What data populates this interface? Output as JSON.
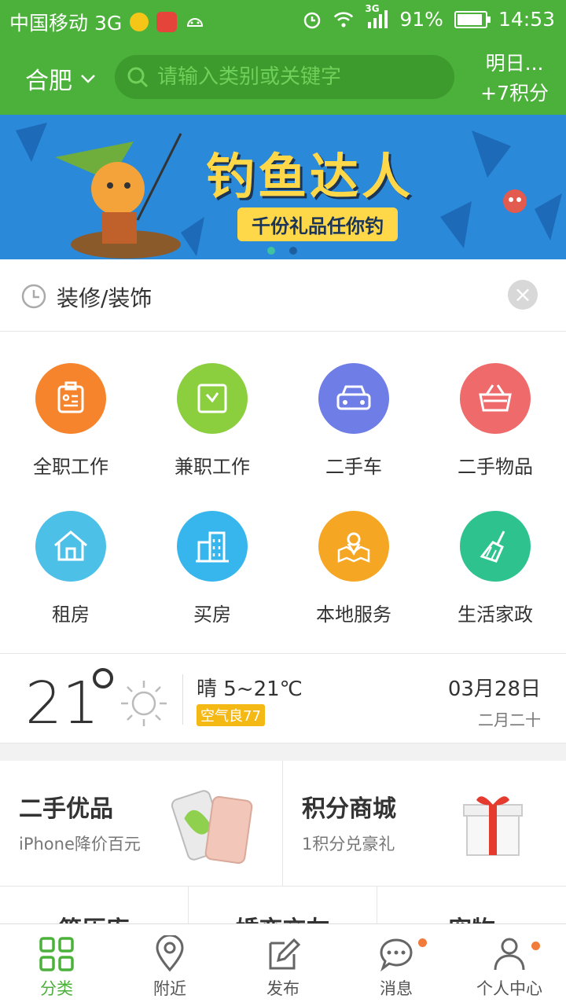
{
  "status_bar": {
    "carrier": "中国移动 3G",
    "network": "3G",
    "battery": "91%",
    "battery_level": 0.91,
    "time": "14:53"
  },
  "header": {
    "city": "合肥",
    "search_placeholder": "请输入类别或关键字",
    "checkin_line1": "明日...",
    "checkin_line2": "+7积分"
  },
  "banner": {
    "title": "钓鱼达人",
    "subtitle": "千份礼品任你钓",
    "active_index": 0,
    "count": 2
  },
  "history": {
    "text": "装修/装饰"
  },
  "categories": [
    {
      "label": "全职工作",
      "icon": "badge-icon",
      "color": "#f5842d"
    },
    {
      "label": "兼职工作",
      "icon": "clock-icon",
      "color": "#8bcf3f"
    },
    {
      "label": "二手车",
      "icon": "car-icon",
      "color": "#6e7ee6"
    },
    {
      "label": "二手物品",
      "icon": "basket-icon",
      "color": "#ef6a6a"
    },
    {
      "label": "租房",
      "icon": "house-icon",
      "color": "#4dc0e8"
    },
    {
      "label": "买房",
      "icon": "building-icon",
      "color": "#37b6ee"
    },
    {
      "label": "本地服务",
      "icon": "map-person-icon",
      "color": "#f5a623"
    },
    {
      "label": "生活家政",
      "icon": "broom-icon",
      "color": "#2ec28e"
    }
  ],
  "weather": {
    "temperature": "21",
    "condition": "晴 5~21℃",
    "aqi": "空气良77",
    "date": "03月28日",
    "lunar": "二月二十"
  },
  "promos": [
    {
      "title": "二手优品",
      "subtitle": "iPhone降价百元",
      "icon": "phone-icon"
    },
    {
      "title": "积分商城",
      "subtitle": "1积分兑豪礼",
      "icon": "gift-icon"
    }
  ],
  "promo_row3": [
    "简历库",
    "婚恋交友",
    "宠物"
  ],
  "nav": [
    {
      "label": "分类",
      "icon": "grid-icon",
      "active": true
    },
    {
      "label": "附近",
      "icon": "location-pin-icon",
      "active": false
    },
    {
      "label": "发布",
      "icon": "edit-icon",
      "active": false
    },
    {
      "label": "消息",
      "icon": "chat-icon",
      "active": false
    },
    {
      "label": "个人中心",
      "icon": "person-icon",
      "active": false
    }
  ],
  "colors": {
    "brand_green": "#4cb13a",
    "search_bg": "#3d9a2d",
    "badge_red": "#f07b3a",
    "aqi_yellow": "#f5b915"
  }
}
